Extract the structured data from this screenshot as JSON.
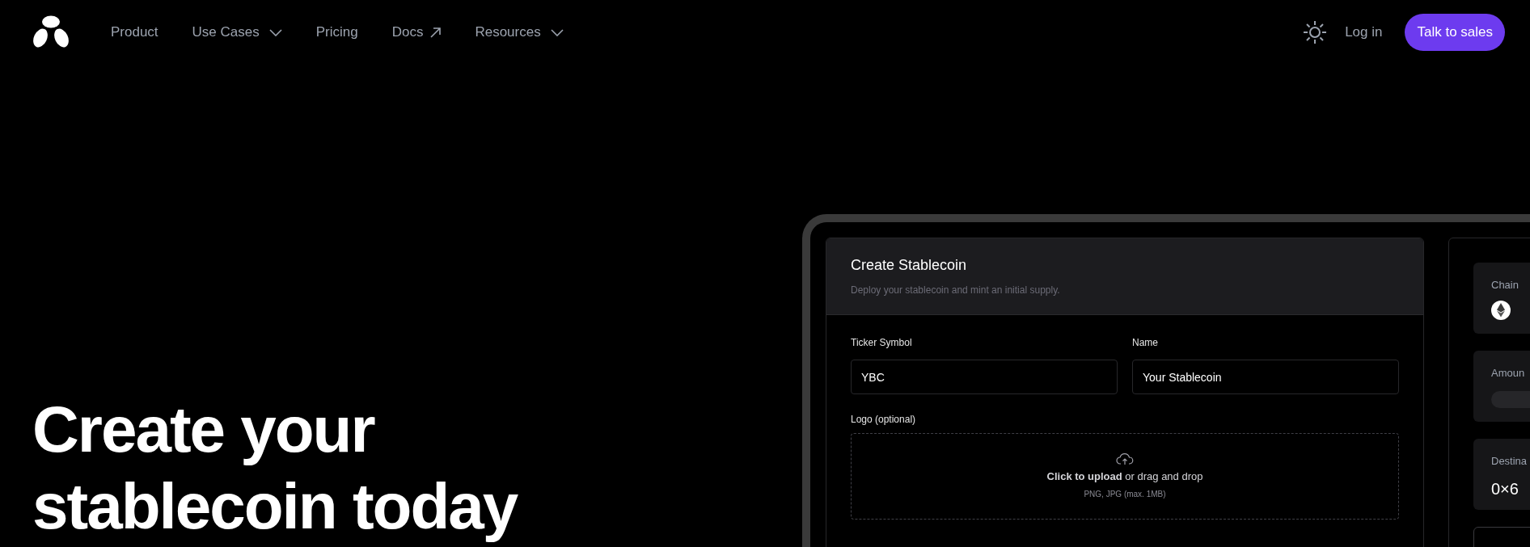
{
  "nav": {
    "items": [
      {
        "label": "Product",
        "kind": "link"
      },
      {
        "label": "Use Cases",
        "kind": "dropdown"
      },
      {
        "label": "Pricing",
        "kind": "link"
      },
      {
        "label": "Docs",
        "kind": "external"
      },
      {
        "label": "Resources",
        "kind": "dropdown"
      }
    ],
    "login": "Log in",
    "cta": "Talk to sales"
  },
  "hero": {
    "title_lines": [
      "Create your",
      "stablecoin today"
    ]
  },
  "form": {
    "title": "Create Stablecoin",
    "subtitle": "Deploy your stablecoin and mint an initial supply.",
    "fields": [
      {
        "label": "Ticker Symbol",
        "value": "YBC"
      },
      {
        "label": "Name",
        "value": "Your Stablecoin"
      }
    ],
    "logo": {
      "label": "Logo (optional)",
      "prompt": "**Click to upload** or drag and drop",
      "hint": "PNG, JPG (max. 1MB)"
    }
  },
  "summary": {
    "cards": [
      {
        "kind": "chain",
        "label": "Chain"
      },
      {
        "kind": "amount",
        "label": "Amoun"
      },
      {
        "kind": "destination",
        "label": "Destina",
        "value": "0×6"
      },
      {
        "kind": "button"
      }
    ]
  }
}
